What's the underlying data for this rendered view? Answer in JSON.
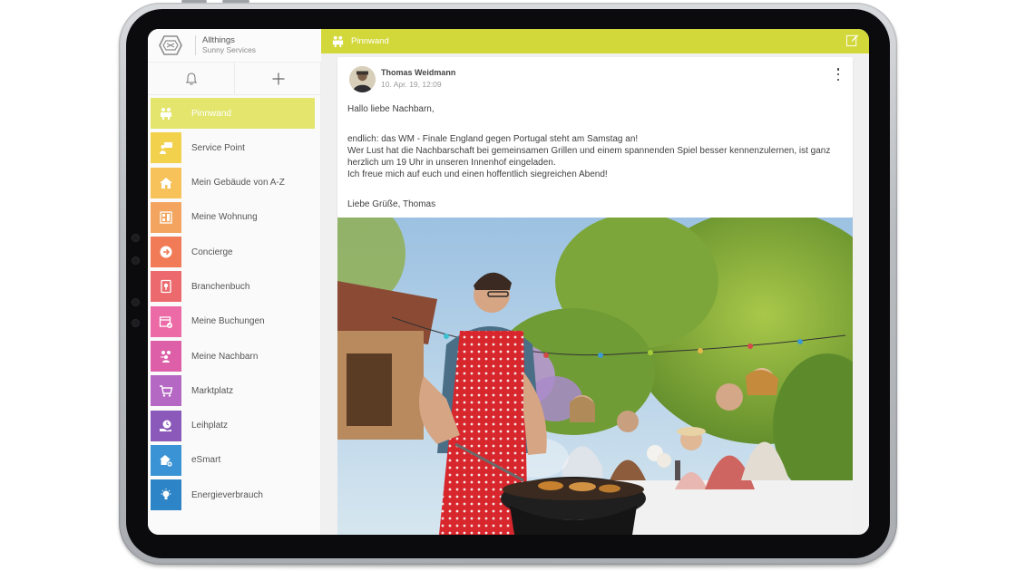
{
  "brand": {
    "name": "Allthings",
    "subtitle": "Sunny Services"
  },
  "quick_actions": {
    "notifications_icon": "bell-icon",
    "add_icon": "plus-icon"
  },
  "topbar": {
    "title": "Pinnwand",
    "icon": "bulletin-board-icon",
    "edit_icon": "edit-icon"
  },
  "menu": {
    "items": [
      {
        "label": "Pinnwand",
        "icon": "bulletin-board-icon",
        "color": "#e3e56d",
        "active": true
      },
      {
        "label": "Service Point",
        "icon": "service-point-icon",
        "color": "#f2d24d"
      },
      {
        "label": "Mein Gebäude von A-Z",
        "icon": "building-icon",
        "color": "#f7c25a"
      },
      {
        "label": "Meine Wohnung",
        "icon": "apartment-icon",
        "color": "#f3a55f"
      },
      {
        "label": "Concierge",
        "icon": "concierge-arrow-icon",
        "color": "#f07b56"
      },
      {
        "label": "Branchenbuch",
        "icon": "directory-pin-icon",
        "color": "#ec6a6e"
      },
      {
        "label": "Meine Buchungen",
        "icon": "calendar-check-icon",
        "color": "#ec6aa6"
      },
      {
        "label": "Meine Nachbarn",
        "icon": "neighbors-icon",
        "color": "#dc5fa8"
      },
      {
        "label": "Marktplatz",
        "icon": "shopping-cart-icon",
        "color": "#b567c4"
      },
      {
        "label": "Leihplatz",
        "icon": "lend-clock-icon",
        "color": "#8a59b9"
      },
      {
        "label": "eSmart",
        "icon": "smart-home-icon",
        "color": "#3a93d4"
      },
      {
        "label": "Energieverbrauch",
        "icon": "lightbulb-icon",
        "color": "#2d84c6"
      }
    ]
  },
  "post": {
    "author": "Thomas Weidmann",
    "time": "10. Apr. 19, 12:09",
    "greeting": "Hallo liebe Nachbarn,",
    "line1": "endlich: das WM - Finale England gegen Portugal steht am Samstag an!",
    "line2": "Wer Lust hat die Nachbarschaft bei gemeinsamen Grillen und einem spannenden Spiel besser kennenzulernen, ist ganz",
    "line3": "herzlich um 19 Uhr in unseren Innenhof eingeladen.",
    "line4": "Ich freue mich auf euch und einen hoffentlich siegreichen Abend!",
    "signoff": "Liebe Grüße, Thomas"
  },
  "colors": {
    "accent": "#d3d83a",
    "active_menu": "#e3e56d"
  }
}
